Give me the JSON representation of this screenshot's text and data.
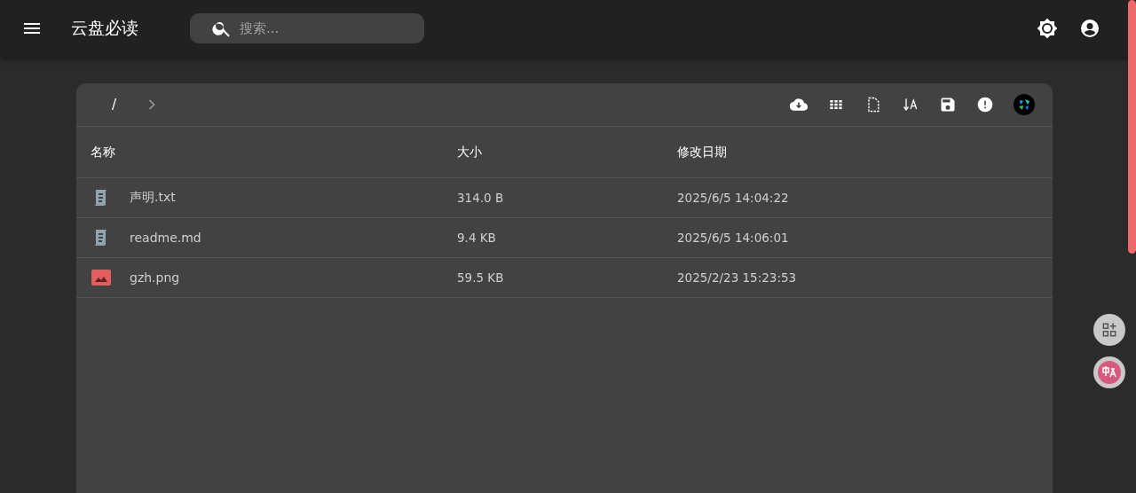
{
  "app_bar": {
    "title": "云盘必读",
    "search": {
      "placeholder": "搜索..."
    }
  },
  "breadcrumb": {
    "path": "/"
  },
  "table": {
    "columns": [
      "名称",
      "大小",
      "修改日期"
    ],
    "rows": [
      {
        "kind": "text",
        "name": "声明.txt",
        "size": "314.0 B",
        "modified": "2025/6/5 14:04:22"
      },
      {
        "kind": "text",
        "name": "readme.md",
        "size": "9.4 KB",
        "modified": "2025/6/5 14:06:01"
      },
      {
        "kind": "image",
        "name": "gzh.png",
        "size": "59.5 KB",
        "modified": "2025/2/23 15:23:53"
      }
    ]
  }
}
